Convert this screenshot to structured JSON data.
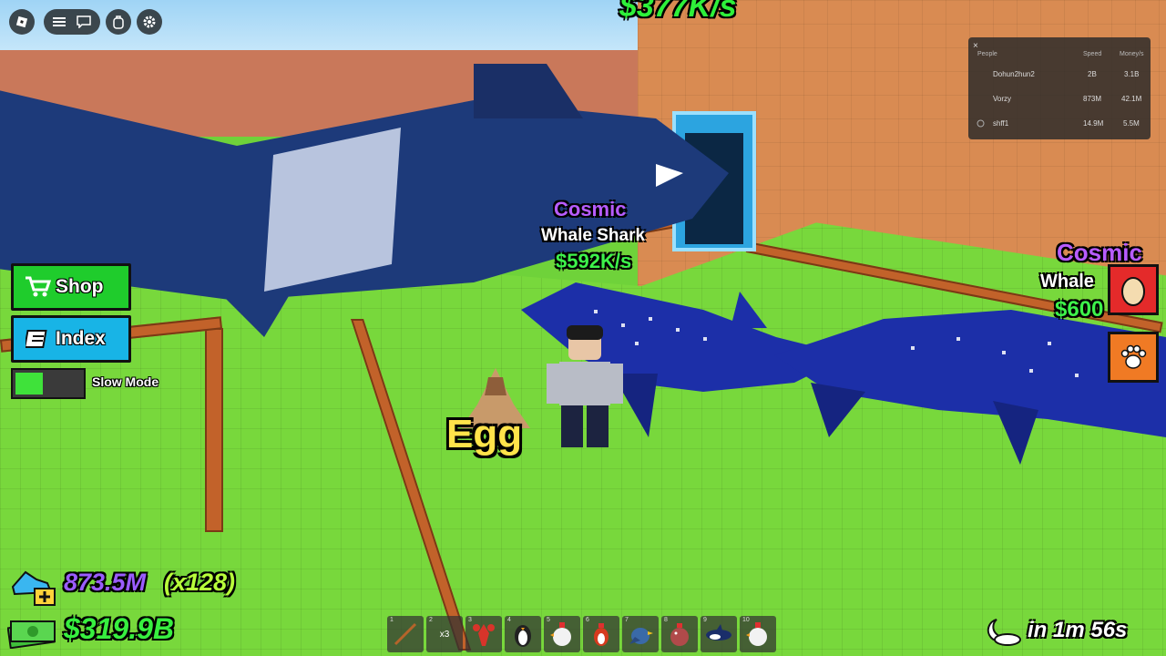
{
  "hud": {
    "income_per_second": "$377K/s"
  },
  "leaderboard": {
    "close_glyph": "×",
    "headers": {
      "people": "People",
      "speed": "Speed",
      "money": "Money/s"
    },
    "rows": [
      {
        "name": "Dohun2hun2",
        "speed": "2B",
        "money": "3.1B"
      },
      {
        "name": "Vorzy",
        "speed": "873M",
        "money": "42.1M"
      },
      {
        "name": "shff1",
        "speed": "14.9M",
        "money": "5.5M"
      }
    ]
  },
  "menu": {
    "shop_label": "Shop",
    "index_label": "Index",
    "slow_mode_label": "Slow Mode",
    "slow_mode_on": true
  },
  "world_labels": {
    "pet1": {
      "rarity": "Cosmic",
      "name": "Whale Shark",
      "income": "$592K/s"
    },
    "pet2": {
      "rarity": "Cosmic",
      "name": "Whale",
      "income": "$600"
    },
    "egg": "Egg"
  },
  "stats": {
    "speed": "873.5M",
    "speed_multiplier": "(x128)",
    "money": "$319.9B",
    "timer": "in 1m 56s"
  },
  "hotbar": [
    {
      "num": "1",
      "icon": "rod-icon",
      "text": ""
    },
    {
      "num": "2",
      "icon": "",
      "text": "x3"
    },
    {
      "num": "3",
      "icon": "lobster-icon",
      "text": ""
    },
    {
      "num": "4",
      "icon": "penguin-icon",
      "text": ""
    },
    {
      "num": "5",
      "icon": "chicken-icon",
      "text": ""
    },
    {
      "num": "6",
      "icon": "rooster-icon",
      "text": ""
    },
    {
      "num": "7",
      "icon": "bird-icon",
      "text": ""
    },
    {
      "num": "8",
      "icon": "hen-icon",
      "text": ""
    },
    {
      "num": "9",
      "icon": "orca-icon",
      "text": ""
    },
    {
      "num": "10",
      "icon": "chicken-icon",
      "text": ""
    }
  ],
  "colors": {
    "cosmic": "#b85cff",
    "income_green": "#3df24a",
    "shop_green": "#1fcc2c",
    "index_blue": "#18b4e6"
  }
}
